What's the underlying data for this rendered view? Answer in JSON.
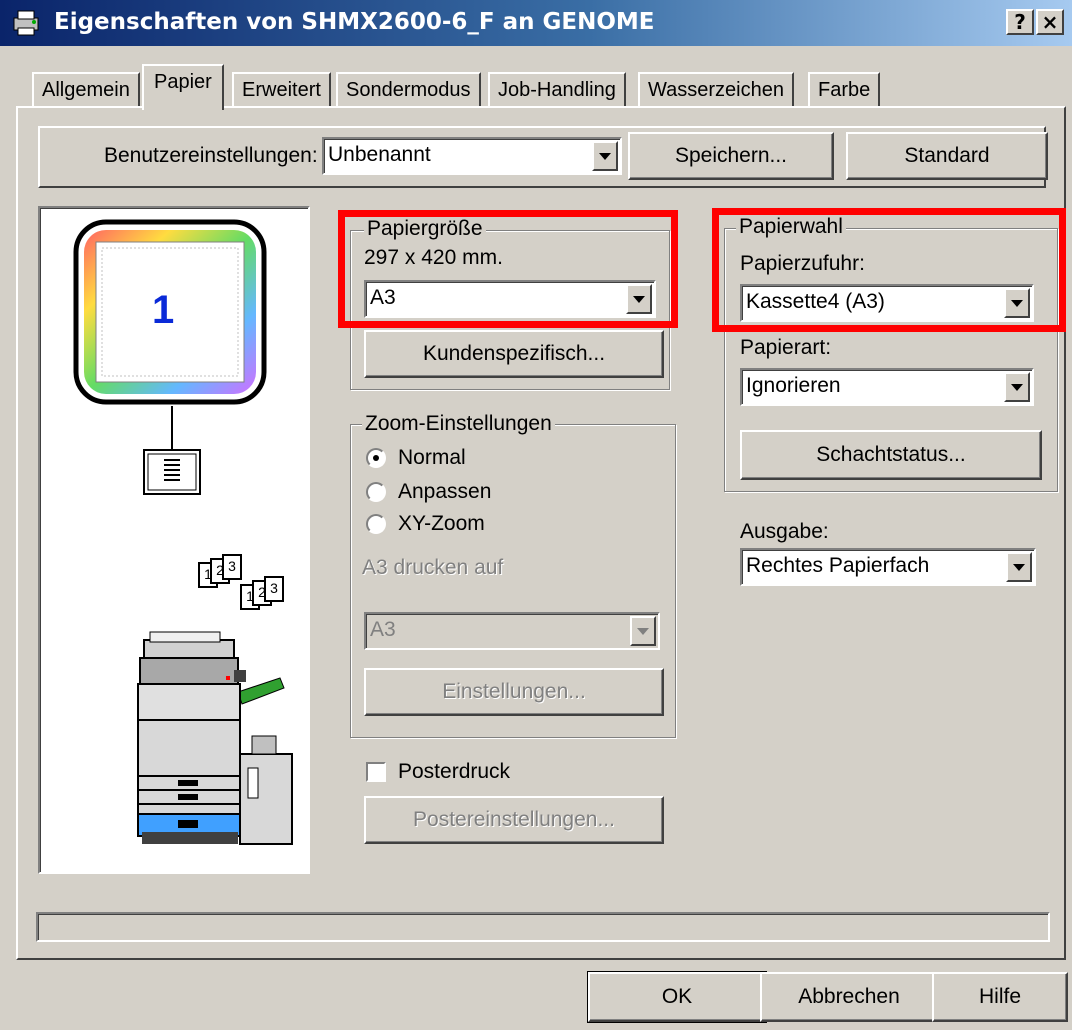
{
  "window": {
    "title": "Eigenschaften von SHMX2600-6_F an GENOME",
    "help_label": "?",
    "close_label": "×"
  },
  "tabs": [
    "Allgemein",
    "Papier",
    "Erweitert",
    "Sondermodus",
    "Job-Handling",
    "Wasserzeichen",
    "Farbe"
  ],
  "active_tab": "Papier",
  "user_settings": {
    "label": "Benutzereinstellungen:",
    "value": "Unbenannt",
    "save_button": "Speichern...",
    "default_button": "Standard"
  },
  "preview": {
    "page_number": "1",
    "collate_labels": [
      "1",
      "2",
      "3"
    ]
  },
  "paper_size": {
    "group_title": "Papiergröße",
    "dimensions": "297 x 420 mm.",
    "value": "A3",
    "custom_button": "Kundenspezifisch..."
  },
  "zoom": {
    "group_title": "Zoom-Einstellungen",
    "options": [
      "Normal",
      "Anpassen",
      "XY-Zoom"
    ],
    "selected": "Normal",
    "print_on_label": "A3 drucken auf",
    "print_on_value": "A3",
    "settings_button": "Einstellungen..."
  },
  "poster": {
    "checkbox_label": "Posterdruck",
    "checked": false,
    "settings_button": "Postereinstellungen..."
  },
  "paper_select": {
    "group_title": "Papierwahl",
    "source_label": "Papierzufuhr:",
    "source_value": "Kassette4 (A3)",
    "type_label": "Papierart:",
    "type_value": "Ignorieren",
    "tray_status_button": "Schachtstatus..."
  },
  "output": {
    "label": "Ausgabe:",
    "value": "Rechtes Papierfach"
  },
  "footer": {
    "ok": "OK",
    "cancel": "Abbrechen",
    "help": "Hilfe"
  },
  "colors": {
    "face": "#d4d0c8",
    "highlight_box": "#ff0000",
    "titlebar": "#0a246a",
    "page_number": "#0a2ad8"
  }
}
